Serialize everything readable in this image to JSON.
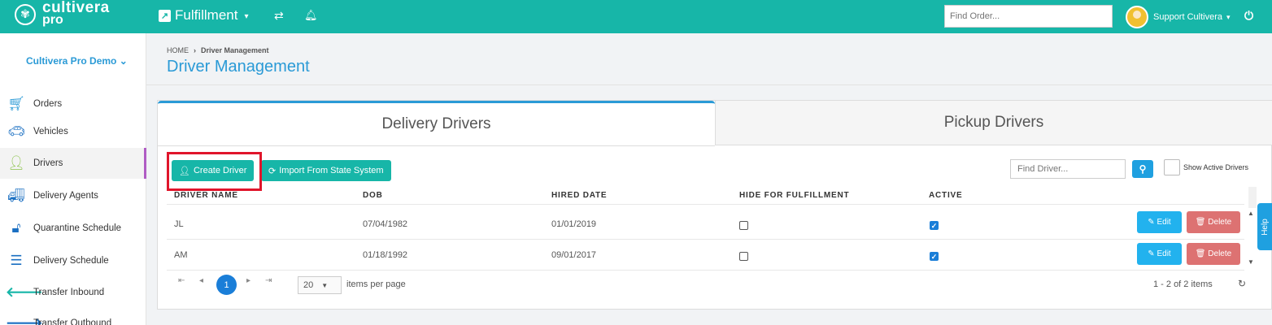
{
  "topbar": {
    "logo_line1": "cultivera",
    "logo_line2": "pro",
    "module_label": "Fulfillment",
    "find_order_placeholder": "Find Order...",
    "user_name": "Support Cultivera",
    "icons": [
      "cannabis-leaf-icon",
      "external-link-icon",
      "swap-icon",
      "bell-icon",
      "power-icon"
    ],
    "color": "#17b6a8"
  },
  "sidebar": {
    "account": "Cultivera Pro Demo",
    "items": [
      {
        "label": "Orders",
        "icon": "cart-icon"
      },
      {
        "label": "Vehicles",
        "icon": "car-icon"
      },
      {
        "label": "Drivers",
        "icon": "user-icon",
        "active": true
      },
      {
        "label": "Delivery Agents",
        "icon": "truck-icon"
      },
      {
        "label": "Quarantine Schedule",
        "icon": "unlock-icon"
      },
      {
        "label": "Delivery Schedule",
        "icon": "list-icon"
      },
      {
        "label": "Transfer Inbound",
        "icon": "arrow-left-icon"
      },
      {
        "label": "Transfer Outbound",
        "icon": "arrow-right-icon"
      }
    ]
  },
  "breadcrumb": {
    "home": "HOME",
    "current": "Driver Management"
  },
  "page_title": "Driver Management",
  "tabs": [
    {
      "label": "Delivery Drivers",
      "active": true
    },
    {
      "label": "Pickup Drivers",
      "active": false
    }
  ],
  "toolbar": {
    "create_label": "Create Driver",
    "import_label": "Import From State System",
    "find_driver_placeholder": "Find Driver...",
    "show_active_label": "Show Active Drivers"
  },
  "table": {
    "columns": [
      "DRIVER NAME",
      "DOB",
      "HIRED DATE",
      "HIDE FOR FULFILLMENT",
      "ACTIVE"
    ],
    "rows": [
      {
        "name": "JL",
        "dob": "07/04/1982",
        "hired": "01/01/2019",
        "hide": false,
        "active": true
      },
      {
        "name": "AM",
        "dob": "01/18/1992",
        "hired": "09/01/2017",
        "hide": false,
        "active": true
      }
    ],
    "edit_label": "Edit",
    "delete_label": "Delete"
  },
  "pager": {
    "current_page": "1",
    "page_size": "20",
    "items_per_page_label": "items per page",
    "count_label": "1 - 2 of 2 items"
  },
  "help_label": "Help"
}
